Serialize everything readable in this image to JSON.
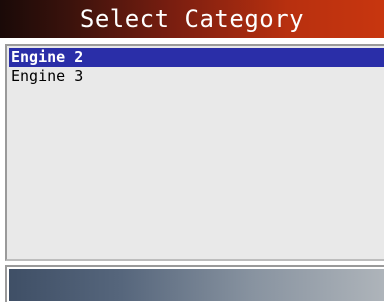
{
  "header": {
    "title": "Select Category"
  },
  "list": {
    "items": [
      {
        "label": "Engine 2",
        "selected": true
      },
      {
        "label": "Engine 3",
        "selected": false
      }
    ]
  },
  "colors": {
    "title_gradient_start": "#1a0a08",
    "title_gradient_end": "#c8360f",
    "selection": "#2a2ea8",
    "list_background": "#e9e9e9",
    "footer_gradient_start": "#3f4f66",
    "footer_gradient_end": "#aeb4ba"
  }
}
